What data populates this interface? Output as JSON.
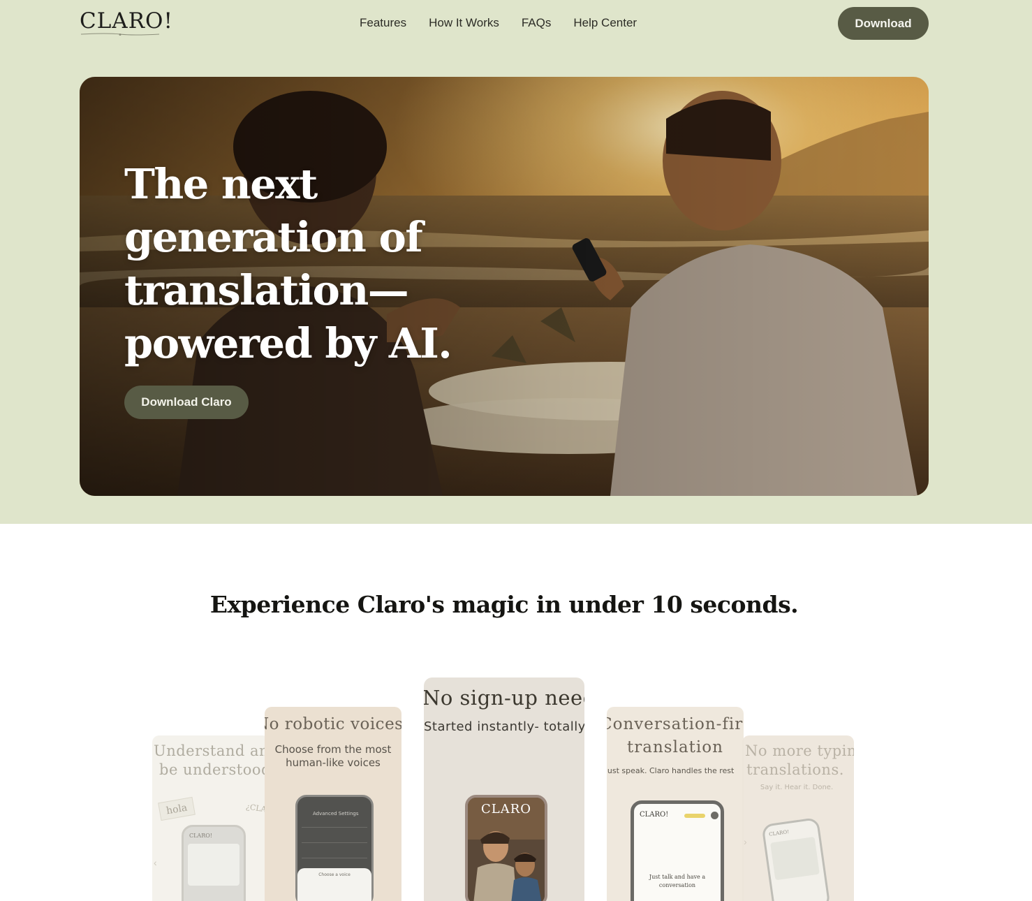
{
  "brand": {
    "logo": "CLARO!"
  },
  "nav": {
    "items": [
      {
        "label": "Features"
      },
      {
        "label": "How It Works"
      },
      {
        "label": "FAQs"
      },
      {
        "label": "Help Center"
      }
    ],
    "download_label": "Download"
  },
  "hero": {
    "title": "The next generation of translation—powered by AI.",
    "cta_label": "Download Claro"
  },
  "experience": {
    "title": "Experience Claro's magic in under 10 seconds.",
    "cards": [
      {
        "heading_1": "Understand and",
        "heading_2": "be understood",
        "word_tag": "hola",
        "word_tag_2": "¿CLAR",
        "phone_logo": "CLARO!"
      },
      {
        "heading": "No robotic voices",
        "sub_1": "Choose from the most",
        "sub_2": "human-like voices",
        "settings_title": "Advanced Settings",
        "panel_label": "Choose a voice"
      },
      {
        "heading": "No sign-up needed",
        "sub": "Started instantly- totally",
        "phone_logo": "CLARO"
      },
      {
        "heading": "Conversation-first",
        "heading_2": "translation",
        "sub": "Just speak. Claro handles the rest",
        "phone_logo": "CLARO!",
        "phone_text_1": "Just talk and have a",
        "phone_text_2": "conversation"
      },
      {
        "heading_1": "No more typing",
        "heading_2": "translations.",
        "sub": "Say it. Hear it. Done.",
        "phone_logo": "CLARO!"
      }
    ]
  },
  "colors": {
    "band": "#dfe5cb",
    "button": "#585b45",
    "button_text": "#f5f5ef"
  }
}
